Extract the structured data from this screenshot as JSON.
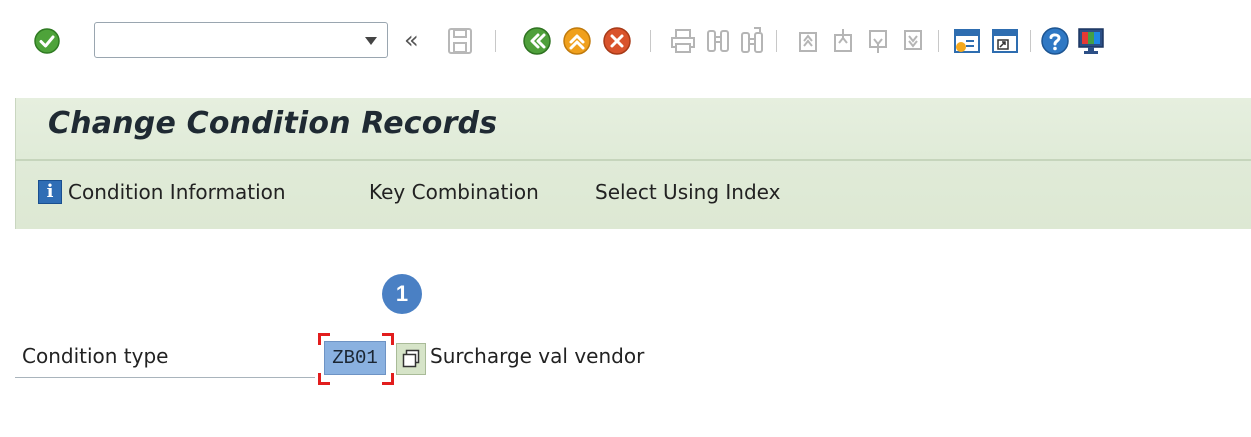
{
  "toolbar": {
    "command_field": {
      "value": "",
      "placeholder": ""
    },
    "expand_symbol": "«",
    "icons": [
      "enter-icon",
      "save-icon",
      "back-icon",
      "exit-icon",
      "cancel-icon",
      "print-icon",
      "find-icon",
      "find-next-icon",
      "first-page-icon",
      "previous-page-icon",
      "next-page-icon",
      "last-page-icon",
      "create-session-icon",
      "shortcut-icon",
      "help-icon",
      "customize-layout-icon"
    ]
  },
  "header": {
    "title": "Change Condition Records"
  },
  "app_toolbar": {
    "items": [
      {
        "label": "Condition Information",
        "icon": "info-icon"
      },
      {
        "label": "Key Combination"
      },
      {
        "label": "Select Using Index"
      }
    ]
  },
  "callout": {
    "number": "1"
  },
  "form": {
    "condition_type": {
      "label": "Condition type",
      "value": "ZB01",
      "description": "Surcharge val vendor"
    }
  },
  "colors": {
    "accent_green": "#dde8d3",
    "field_highlight": "#8ab1e0",
    "callout_blue": "#4a80c4",
    "marker_red": "#e21d1d"
  }
}
